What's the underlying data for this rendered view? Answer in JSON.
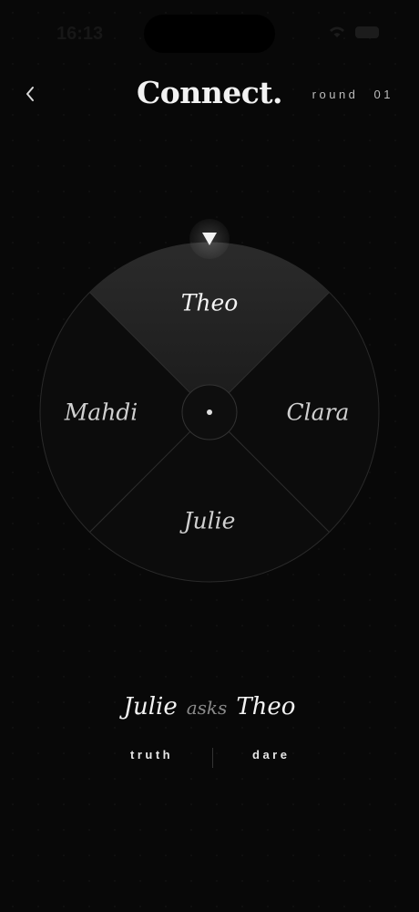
{
  "status_bar": {
    "time": "16:13"
  },
  "header": {
    "title": "Connect.",
    "round_label": "round",
    "round_number": "01"
  },
  "wheel": {
    "players": [
      {
        "name": "Theo",
        "active": true
      },
      {
        "name": "Clara",
        "active": false
      },
      {
        "name": "Julie",
        "active": false
      },
      {
        "name": "Mahdi",
        "active": false
      }
    ]
  },
  "result": {
    "asker": "Julie",
    "verb": "asks",
    "target": "Theo"
  },
  "choices": {
    "truth": "truth",
    "dare": "dare"
  }
}
